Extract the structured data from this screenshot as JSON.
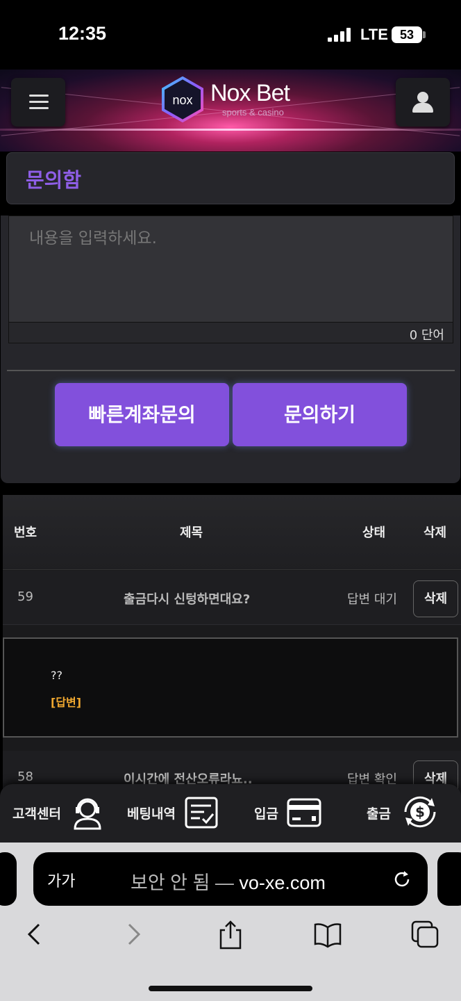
{
  "status_bar": {
    "time": "12:35",
    "network": "LTE",
    "battery": "53"
  },
  "header": {
    "logo_mark": "nox",
    "logo_title": "Nox Bet",
    "logo_subtitle": "sports & casino"
  },
  "page": {
    "title": "문의함"
  },
  "form": {
    "placeholder": "내용을 입력하세요.",
    "word_count": "0 단어",
    "quick_button": "빠른계좌문의",
    "submit_button": "문의하기"
  },
  "table": {
    "headers": {
      "no": "번호",
      "title": "제목",
      "status": "상태",
      "delete": "삭제"
    },
    "rows": [
      {
        "no": "59",
        "title": "출금다시 신텅하면대요?",
        "status": "답변 대기",
        "delete": "삭제"
      },
      {
        "no": "58",
        "title": "이시간에 전산오류라뇨..",
        "status": "답변 확인",
        "delete": "삭제"
      }
    ],
    "expanded": {
      "question": "??",
      "answer_label": "[답변]"
    }
  },
  "bottom_nav": [
    {
      "label": "고객센터",
      "icon": "headset-agent-icon"
    },
    {
      "label": "베팅내역",
      "icon": "betting-slip-icon"
    },
    {
      "label": "입금",
      "icon": "credit-card-icon"
    },
    {
      "label": "출금",
      "icon": "dollar-exchange-icon"
    }
  ],
  "browser": {
    "aa": "가가",
    "security": "보안 안 됨 — ",
    "host": "vo-xe.com"
  },
  "colors": {
    "accent_purple": "#8250dc",
    "title_purple": "#8e5ee6",
    "answer_gold": "#f0a830"
  }
}
